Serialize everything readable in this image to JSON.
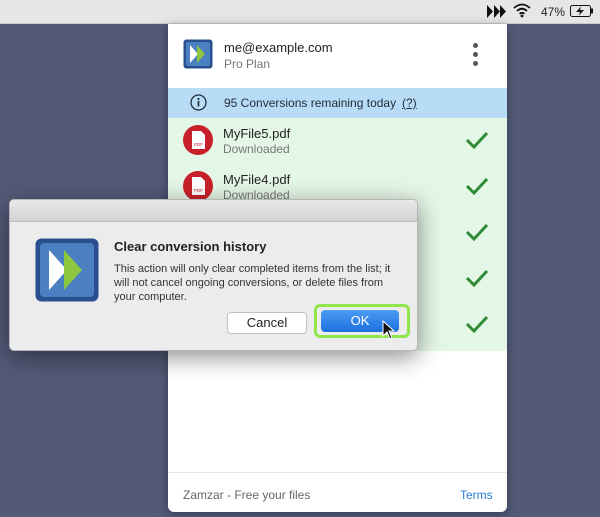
{
  "menubar": {
    "battery_percent": "47%",
    "icons": [
      "zamzar-app-icon",
      "wifi-icon",
      "battery-charging-icon"
    ]
  },
  "panel": {
    "account": {
      "email": "me@example.com",
      "plan": "Pro Plan"
    },
    "info": {
      "text": "95 Conversions remaining today",
      "help_link": "(?)"
    },
    "files": [
      {
        "name": "MyFile5.pdf",
        "status": "Downloaded",
        "icon_label": "PDF"
      },
      {
        "name": "MyFile4.pdf",
        "status": "Downloaded",
        "icon_label": "PDF"
      }
    ],
    "hidden_completed_count": 3,
    "footer": {
      "text": "Zamzar - Free your files",
      "link": "Terms"
    }
  },
  "dialog": {
    "title": "Clear conversion history",
    "message": "This action will only clear completed items from the list; it will not cancel ongoing conversions, or delete files from your computer.",
    "cancel_label": "Cancel",
    "ok_label": "OK"
  },
  "colors": {
    "desktop": "#525a78",
    "info_bar": "#b9dcf6",
    "list_bg": "#e4f6e6",
    "check_green": "#2e8b36",
    "pdf_red": "#c8202a",
    "ok_blue": "#1b6fe0",
    "highlight_green": "#8ee64a",
    "link_blue": "#2a7bd6"
  }
}
